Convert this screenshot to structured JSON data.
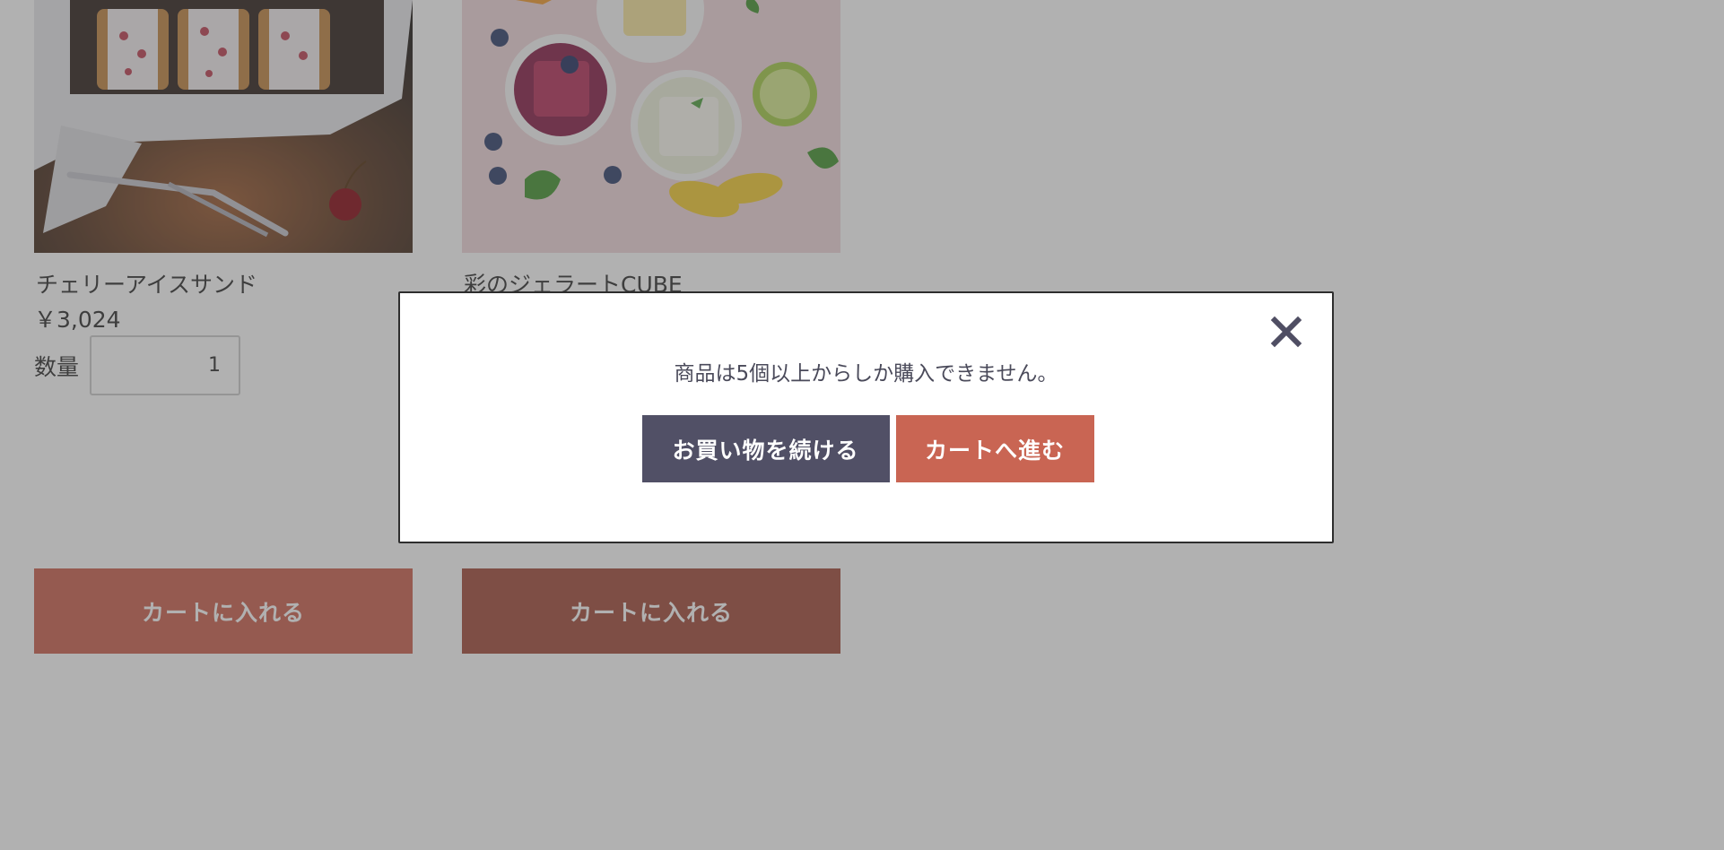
{
  "products": [
    {
      "name": "チェリーアイスサンド",
      "price": "￥3,024",
      "qty_label": "数量",
      "qty_value": "1",
      "add_to_cart": "カートに入れる",
      "image": "cherry-ice-sandwich-photo"
    },
    {
      "name": "彩のジェラートCUBE",
      "add_to_cart": "カートに入れる",
      "image": "gelato-cube-photo"
    }
  ],
  "modal": {
    "message": "商品は5個以上からしか購入できません。",
    "continue_label": "お買い物を続ける",
    "cart_label": "カートへ進む",
    "close_icon": "close-icon"
  },
  "colors": {
    "primary_button": "#515066",
    "accent_button": "#c96553",
    "add_to_cart_button": "#cf6a58",
    "overlay": "rgba(70,70,70,0.42)"
  }
}
